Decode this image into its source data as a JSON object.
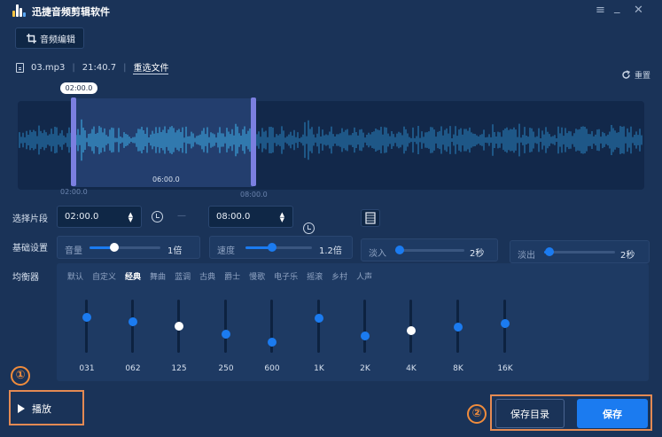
{
  "app": {
    "title": "迅捷音频剪辑软件"
  },
  "window": {
    "menu_icon": "menu-icon",
    "minimize_icon": "minimize-icon",
    "close_icon": "close-icon"
  },
  "tab": {
    "label": "音频编辑",
    "icon": "crop-icon"
  },
  "file": {
    "name": "03.mp3",
    "duration": "21:40.7",
    "reselect_label": "重选文件"
  },
  "reset": {
    "label": "重置"
  },
  "waveform": {
    "selection_start_bubble": "02:00.0",
    "start_label": "02:00.0",
    "middle_label": "06:00.0",
    "end_label": "08:00.0"
  },
  "segment": {
    "label": "选择片段",
    "start_value": "02:00.0",
    "end_value": "08:00.0",
    "dash": "—"
  },
  "basic": {
    "label": "基础设置",
    "volume": {
      "label": "音量",
      "value": "1倍",
      "level": 0.35
    },
    "speed": {
      "label": "速度",
      "value": "1.2倍",
      "level": 0.4
    },
    "fade_in": {
      "label": "淡入",
      "value": "2秒",
      "level": 0.07
    },
    "fade_out": {
      "label": "淡出",
      "value": "2秒",
      "level": 0.07
    }
  },
  "equalizer": {
    "label": "均衡器",
    "presets": [
      "默认",
      "自定义",
      "经典",
      "舞曲",
      "蓝调",
      "古典",
      "爵士",
      "慢歌",
      "电子乐",
      "摇滚",
      "乡村",
      "人声"
    ],
    "active_preset": "经典",
    "bands": [
      {
        "label": "031",
        "level": 0.67
      },
      {
        "label": "062",
        "level": 0.58
      },
      {
        "label": "125",
        "level": 0.5
      },
      {
        "label": "250",
        "level": 0.35
      },
      {
        "label": "600",
        "level": 0.2
      },
      {
        "label": "1K",
        "level": 0.65
      },
      {
        "label": "2K",
        "level": 0.32
      },
      {
        "label": "4K",
        "level": 0.42
      },
      {
        "label": "8K",
        "level": 0.48
      },
      {
        "label": "16K",
        "level": 0.55
      }
    ]
  },
  "annotations": {
    "one": "①",
    "two": "②"
  },
  "play": {
    "label": "播放",
    "icon": "play-icon"
  },
  "save": {
    "dir_label": "保存目录",
    "save_label": "保存"
  },
  "colors": {
    "accent": "#1b7bf0",
    "background": "#1a3358",
    "annotation": "#e48a53"
  }
}
